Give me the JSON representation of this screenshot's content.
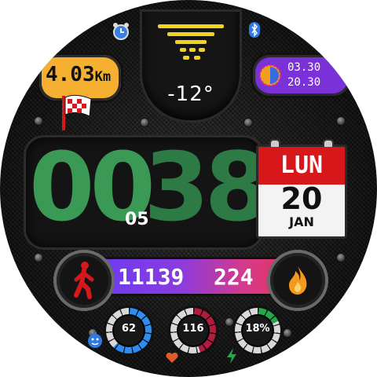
{
  "weather": {
    "temperature": "-12°",
    "icon": "sun-icon"
  },
  "distance": {
    "value": "4.03",
    "unit": "Km",
    "icon": "checkered-flag-icon"
  },
  "sun": {
    "sunrise": "03.30",
    "sunset": "20.30",
    "icon": "sun-moon-icon"
  },
  "status": {
    "alarm_icon": "alarm-clock-icon",
    "bluetooth_icon": "bluetooth-icon"
  },
  "time": {
    "hours": "00",
    "minutes": "38",
    "seconds": "05"
  },
  "calendar": {
    "weekday": "LUN",
    "day": "20",
    "month": "JAN"
  },
  "activity": {
    "steps": "11139",
    "calories": "224",
    "steps_icon": "walking-person-icon",
    "calories_icon": "flame-icon"
  },
  "gauges": {
    "battery": {
      "value": "62",
      "level": 0.62,
      "color": "#2f8cf0",
      "icon": "battery-face-icon"
    },
    "heart_rate": {
      "value": "116",
      "level": 0.45,
      "color": "#b01c3c",
      "icon": "heart-icon"
    },
    "charge": {
      "value": "18%",
      "level": 0.18,
      "color": "#27a64a",
      "icon": "lightning-icon"
    }
  },
  "colors": {
    "hours": "#3a9a55",
    "minutes": "#2e7a44",
    "distance_bg": "#f5b031",
    "sun_bg": "#7a31d8",
    "calendar_header": "#d8171b"
  }
}
